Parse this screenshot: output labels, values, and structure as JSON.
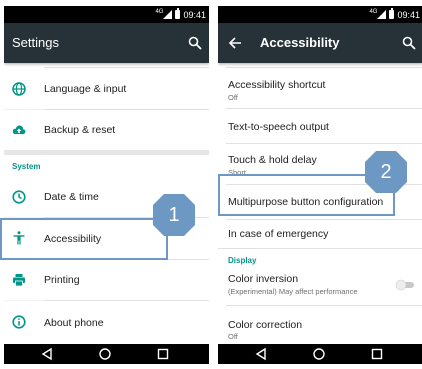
{
  "status_bar": {
    "signal": "4G",
    "time": "09:41"
  },
  "left_screen": {
    "title": "Settings",
    "items_top": [
      {
        "label": "Language & input",
        "icon": "globe-icon"
      },
      {
        "label": "Backup & reset",
        "icon": "cloud-upload-icon"
      }
    ],
    "section": "System",
    "items_system": [
      {
        "label": "Date & time",
        "icon": "clock-icon"
      },
      {
        "label": "Accessibility",
        "icon": "accessibility-icon",
        "highlighted": true
      },
      {
        "label": "Printing",
        "icon": "printer-icon"
      },
      {
        "label": "About phone",
        "icon": "info-icon"
      }
    ],
    "callout": "1"
  },
  "right_screen": {
    "title": "Accessibility",
    "items": [
      {
        "label": "Accessibility shortcut",
        "sub": "Off"
      },
      {
        "label": "Text-to-speech output",
        "sub": ""
      },
      {
        "label": "Touch & hold delay",
        "sub": "Short"
      },
      {
        "label": "Multipurpose button configuration",
        "sub": "",
        "highlighted": true
      },
      {
        "label": "In case of emergency",
        "sub": ""
      }
    ],
    "section": "Display",
    "items_display": [
      {
        "label": "Color inversion",
        "sub": "(Experimental) May affect performance",
        "toggle": "off"
      },
      {
        "label": "Color correction",
        "sub": "Off"
      }
    ],
    "callout": "2"
  },
  "nav_bar": {
    "buttons": [
      "back-triangle-icon",
      "home-circle-icon",
      "recents-square-icon"
    ]
  },
  "colors": {
    "app_bar": "#263238",
    "accent": "#009688",
    "highlight_box": "#6d98c4",
    "callout_badge": "#6d98c4"
  }
}
